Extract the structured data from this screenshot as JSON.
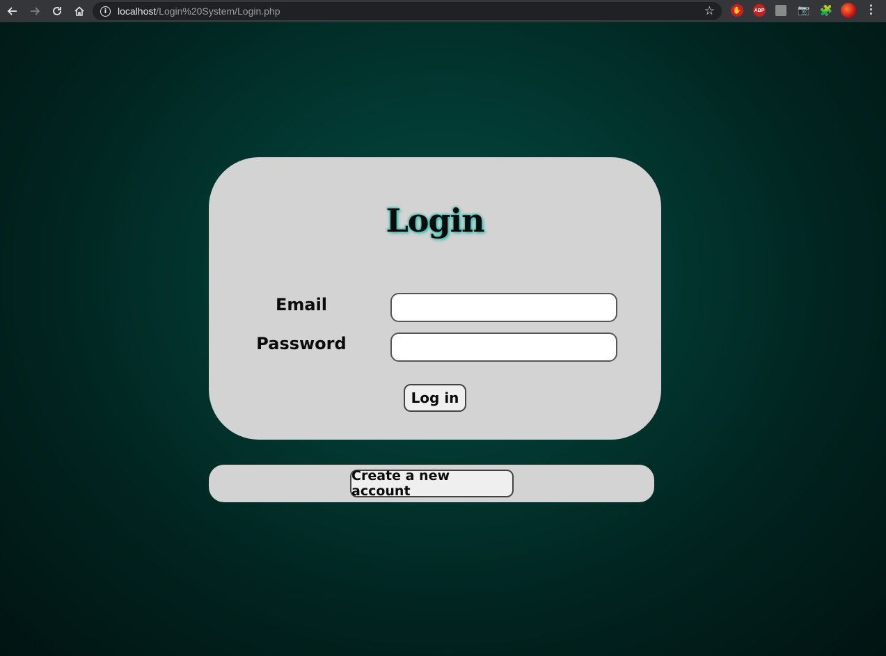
{
  "browser": {
    "back_icon": "arrow-left-icon",
    "forward_icon": "arrow-right-icon",
    "reload_icon": "reload-icon",
    "home_icon": "home-icon",
    "url_host": "localhost",
    "url_path": "/Login%20System/Login.php",
    "bookmark_icon": "star-icon",
    "extensions": [
      "stop-icon",
      "adblock-icon",
      "extension-icon",
      "camera-icon",
      "puzzle-icon",
      "profile-avatar-icon"
    ],
    "abp_label": "ABP",
    "menu_icon": "more-vert-icon"
  },
  "login": {
    "title": "Login",
    "email_label": "Email",
    "email_value": "",
    "password_label": "Password",
    "password_value": "",
    "submit_label": "Log in"
  },
  "signup": {
    "button_label": "Create a new account"
  },
  "colors": {
    "card_bg": "#d3d3d3",
    "page_bg": "#03473f",
    "title_glow": "#1fb8a8"
  }
}
